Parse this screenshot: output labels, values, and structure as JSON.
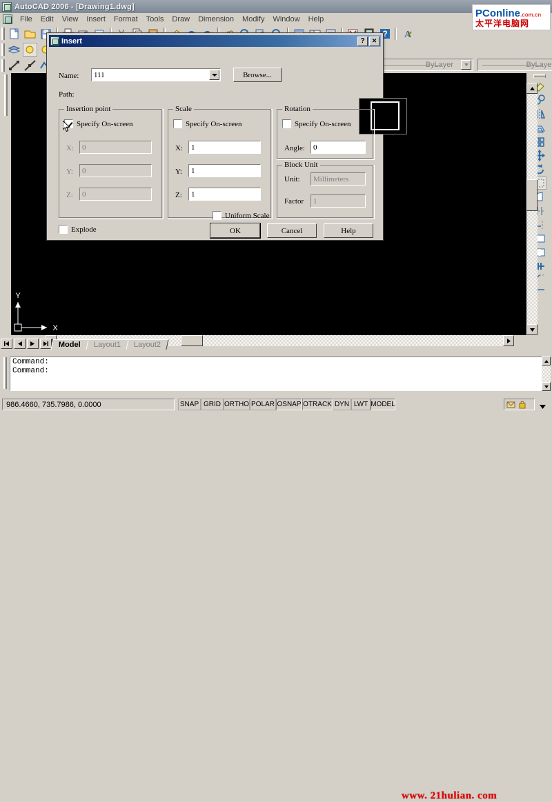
{
  "window": {
    "title": "AutoCAD 2006 - [Drawing1.dwg]",
    "app_icon": "autocad-icon"
  },
  "menubar": {
    "items": [
      {
        "label": "File"
      },
      {
        "label": "Edit"
      },
      {
        "label": "View"
      },
      {
        "label": "Insert"
      },
      {
        "label": "Format"
      },
      {
        "label": "Tools"
      },
      {
        "label": "Draw"
      },
      {
        "label": "Dimension"
      },
      {
        "label": "Modify"
      },
      {
        "label": "Window"
      },
      {
        "label": "Help"
      }
    ]
  },
  "properties_toolbar": {
    "color_value": "ByLayer",
    "linetype_value": "ByLayer"
  },
  "logo": {
    "brand_p": "P",
    "brand_online": "Conline",
    "brand_domain": ".com.cn",
    "brand_cn": "太平洋电脑网"
  },
  "watermark": {
    "url": "www. 21hulian. com"
  },
  "dialog": {
    "title": "Insert",
    "icon": "autocad-icon",
    "help_button": "?",
    "close_button": "✕",
    "name_label": "Name:",
    "name_value": "111",
    "browse_label": "Browse...",
    "path_label": "Path:",
    "path_value": "",
    "preview_name": "block-preview",
    "insertion_point": {
      "title": "Insertion point",
      "specify_onscreen_label": "Specify On-screen",
      "specify_onscreen_checked": true,
      "x_label": "X:",
      "x_value": "0",
      "y_label": "Y:",
      "y_value": "0",
      "z_label": "Z:",
      "z_value": "0",
      "fields_disabled": true
    },
    "scale": {
      "title": "Scale",
      "specify_onscreen_label": "Specify On-screen",
      "specify_onscreen_checked": false,
      "x_label": "X:",
      "x_value": "1",
      "y_label": "Y:",
      "y_value": "1",
      "z_label": "Z:",
      "z_value": "1",
      "uniform_scale_label": "Uniform Scale",
      "uniform_scale_checked": false
    },
    "rotation": {
      "title": "Rotation",
      "specify_onscreen_label": "Specify On-screen",
      "specify_onscreen_checked": false,
      "angle_label": "Angle:",
      "angle_value": "0"
    },
    "block_unit": {
      "title": "Block Unit",
      "unit_label": "Unit:",
      "unit_value": "Millimeters",
      "factor_label": "Factor",
      "factor_value": "1"
    },
    "explode_label": "Explode",
    "explode_checked": false,
    "ok_label": "OK",
    "cancel_label": "Cancel",
    "help_label": "Help"
  },
  "layout_tabs": {
    "tabs": [
      {
        "label": "Model",
        "active": true
      },
      {
        "label": "Layout1",
        "active": false
      },
      {
        "label": "Layout2",
        "active": false
      }
    ]
  },
  "command_window": {
    "lines": [
      "Command:",
      "Command:"
    ],
    "text": "Command:\nCommand:"
  },
  "statusbar": {
    "coordinates": "986.4660,   735.7986,  0.0000",
    "toggles": [
      {
        "label": "SNAP",
        "on": false
      },
      {
        "label": "GRID",
        "on": false
      },
      {
        "label": "ORTHO",
        "on": false
      },
      {
        "label": "POLAR",
        "on": false
      },
      {
        "label": "OSNAP",
        "on": true
      },
      {
        "label": "OTRACK",
        "on": true
      },
      {
        "label": "DYN",
        "on": false
      },
      {
        "label": "LWT",
        "on": false
      },
      {
        "label": "MODEL",
        "on": true
      }
    ]
  },
  "colors": {
    "face": "#d4d0c8",
    "title_active": "#0a246a",
    "drawing_bg": "#000000",
    "selection": "#0a246a",
    "watermark_red": "#e00000"
  }
}
